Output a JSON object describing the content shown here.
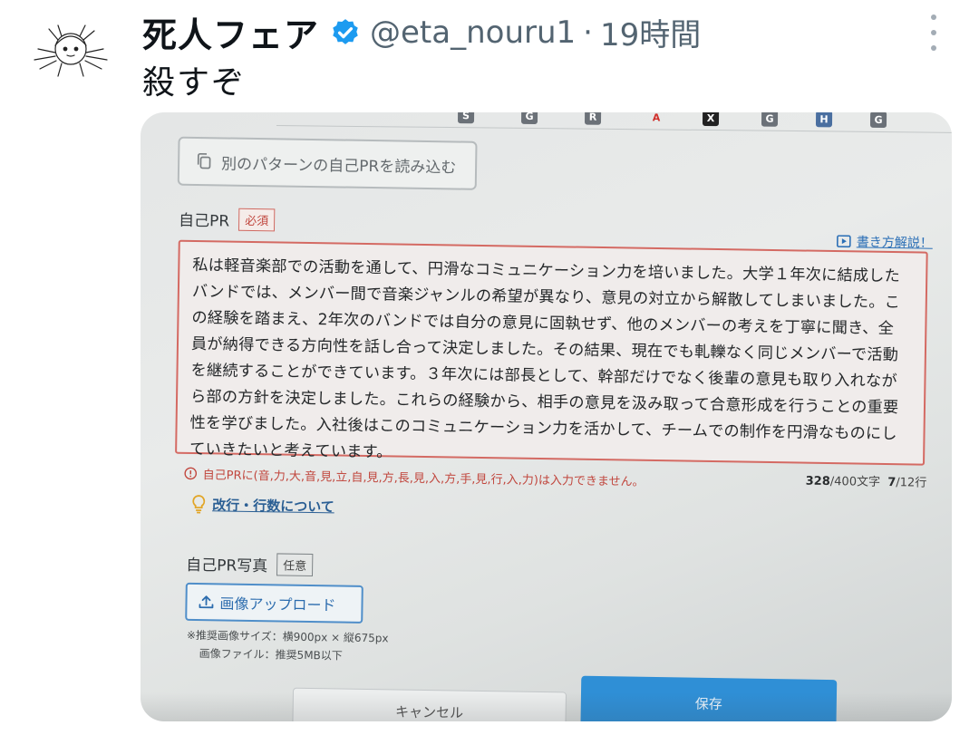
{
  "tweet": {
    "display_name": "死人フェア",
    "handle": "@eta_nouru1",
    "separator": "·",
    "time": "19時間",
    "text": "殺すぞ",
    "verified_icon": "verified-badge-icon",
    "more_icon": "more-vertical-icon"
  },
  "photo": {
    "tab_icons": [
      {
        "name": "s-tab-icon",
        "glyph": "S"
      },
      {
        "name": "g-tab-icon",
        "glyph": "G"
      },
      {
        "name": "r-tab-icon",
        "glyph": "R"
      },
      {
        "name": "adobe-tab-icon",
        "glyph": "A"
      },
      {
        "name": "x-tab-icon",
        "glyph": "X"
      },
      {
        "name": "g-tab-icon",
        "glyph": "G"
      },
      {
        "name": "save-tab-icon",
        "glyph": "H"
      },
      {
        "name": "g-tab-icon",
        "glyph": "G"
      }
    ],
    "load_pattern_label": "別のパターンの自己PRを読み込む",
    "pr_label": "自己PR",
    "required_badge": "必須",
    "howto_link": "書き方解説！",
    "pr_text": "私は軽音楽部での活動を通して、円滑なコミュニケーション力を培いました。大学１年次に結成した\nバンドでは、メンバー間で音楽ジャンルの希望が異なり、意見の対立から解散してしまいました。こ\nの経験を踏まえ、2年次のバンドでは自分の意見に固執せず、他のメンバーの考えを丁寧に聞き、全\n員が納得できる方向性を話し合って決定しました。その結果、現在でも軋轢なく同じメンバーで活動\nを継続することができています。３年次には部長として、幹部だけでなく後輩の意見も取り入れなが\nら部の方針を決定しました。これらの経験から、相手の意見を汲み取って合意形成を行うことの重要\n性を学びました。入社後はこのコミュニケーション力を活かして、チームでの制作を円滑なものにし\nていきたいと考えています。",
    "error_message": "自己PRに(音,力,大,音,見,立,自,見,方,長,見,入,方,手,見,行,入,力)は入力できません。",
    "char_count": "328",
    "char_limit": "/400文字",
    "line_count": "7",
    "line_limit": "/12行",
    "tips_link": "改行・行数について",
    "photo_label": "自己PR写真",
    "optional_badge": "任意",
    "upload_button": "画像アップロード",
    "note_line1": "※推奨画像サイズ：横900px × 縦675px",
    "note_line2": "画像ファイル：推奨5MB以下",
    "cancel_button": "キャンセル",
    "save_button": "保存"
  },
  "colors": {
    "verified": "#1d9bf0",
    "error_red": "#c1473e",
    "link_blue": "#2b6fb6",
    "save_blue": "#2f8fd6"
  }
}
